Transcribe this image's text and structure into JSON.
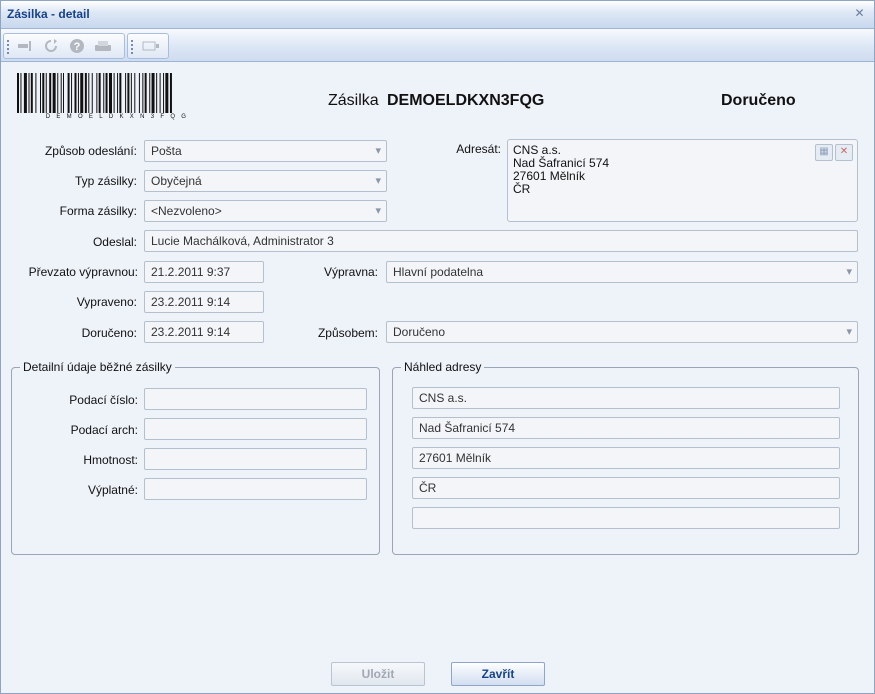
{
  "window": {
    "title": "Zásilka - detail",
    "close_label": "✕"
  },
  "header": {
    "label": "Zásilka",
    "code": "DEMOELDKXN3FQG",
    "status": "Doručeno",
    "barcode_text": "DEMOELDKXN3FQG"
  },
  "form": {
    "zpusob_odeslani": {
      "label": "Způsob odeslání:",
      "value": "Pošta"
    },
    "typ_zasilky": {
      "label": "Typ zásilky:",
      "value": "Obyčejná"
    },
    "forma_zasilky": {
      "label": "Forma zásilky:",
      "value": "<Nezvoleno>"
    },
    "adresat": {
      "label": "Adresát:",
      "lines": [
        "CNS a.s.",
        "Nad Šafranicí 574",
        "27601 Mělník",
        "ČR"
      ]
    },
    "odeslal": {
      "label": "Odeslal:",
      "value": "Lucie Machálková, Administrator 3"
    },
    "prevzato": {
      "label": "Převzato výpravnou:",
      "value": "21.2.2011 9:37"
    },
    "vypravna": {
      "label": "Výpravna:",
      "value": "Hlavní podatelna"
    },
    "vypraveno": {
      "label": "Vypraveno:",
      "value": "23.2.2011 9:14"
    },
    "doruceno": {
      "label": "Doručeno:",
      "value": "23.2.2011 9:14"
    },
    "zpusobem": {
      "label": "Způsobem:",
      "value": "Doručeno"
    }
  },
  "detail": {
    "legend": "Detailní údaje běžné zásilky",
    "podaci_cislo": {
      "label": "Podací číslo:",
      "value": ""
    },
    "podaci_arch": {
      "label": "Podací arch:",
      "value": ""
    },
    "hmotnost": {
      "label": "Hmotnost:",
      "value": ""
    },
    "vyplatne": {
      "label": "Výplatné:",
      "value": ""
    }
  },
  "preview": {
    "legend": "Náhled adresy",
    "lines": [
      "CNS a.s.",
      "Nad Šafranicí 574",
      "27601 Mělník",
      "ČR",
      ""
    ]
  },
  "buttons": {
    "save": "Uložit",
    "close": "Zavřít"
  },
  "icons": [
    "export-icon",
    "refresh-icon",
    "help-icon",
    "print-icon",
    "edit-icon"
  ]
}
